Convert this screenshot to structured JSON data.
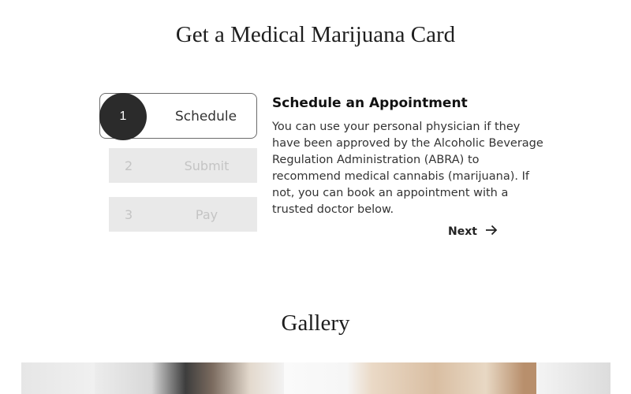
{
  "page_title": "Get a Medical Marijuana Card",
  "steps": [
    {
      "number": "1",
      "label": "Schedule",
      "active": true
    },
    {
      "number": "2",
      "label": "Submit",
      "active": false
    },
    {
      "number": "3",
      "label": "Pay",
      "active": false
    }
  ],
  "content": {
    "heading": "Schedule an Appointment",
    "body": "You can use your personal physician if they have been approved by the Alcoholic Beverage Regulation Administration (ABRA) to recommend medical cannabis (marijuana). If not, you can book an appointment with a trusted doctor below.",
    "next_label": "Next"
  },
  "gallery": {
    "title": "Gallery"
  },
  "icons": {
    "next": "arrow-right-icon"
  }
}
